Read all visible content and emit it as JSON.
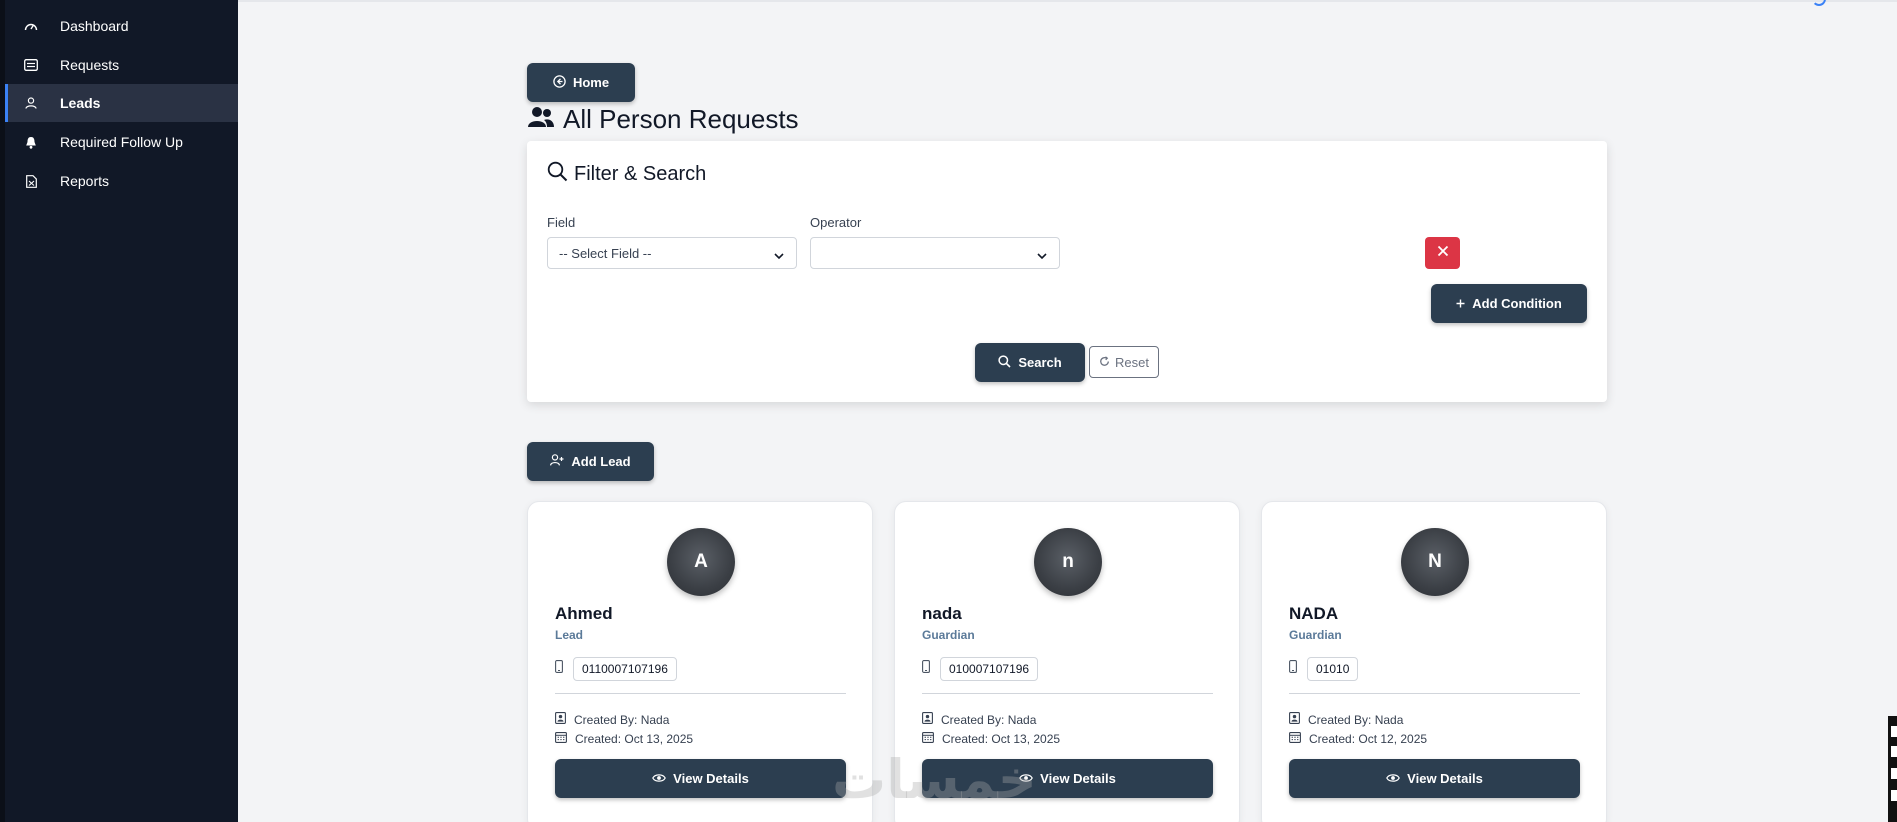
{
  "sidebar": {
    "items": [
      {
        "label": "Dashboard",
        "icon": "gauge-icon",
        "active": false
      },
      {
        "label": "Requests",
        "icon": "list-icon",
        "active": false
      },
      {
        "label": "Leads",
        "icon": "user-icon",
        "active": true
      },
      {
        "label": "Required Follow Up",
        "icon": "bell-icon",
        "active": false
      },
      {
        "label": "Reports",
        "icon": "report-file-icon",
        "active": false
      }
    ]
  },
  "header": {
    "home_label": "Home",
    "title": "All Person Requests"
  },
  "filter": {
    "title": "Filter & Search",
    "field_label": "Field",
    "field_value": "-- Select Field --",
    "operator_label": "Operator",
    "operator_value": "",
    "add_condition_label": "Add Condition",
    "search_label": "Search",
    "reset_label": "Reset"
  },
  "add_lead_label": "Add Lead",
  "cards": [
    {
      "initial": "A",
      "name": "Ahmed",
      "role": "Lead",
      "phone": "0110007107196",
      "created_by": "Created By: Nada",
      "created": "Created: Oct 13, 2025",
      "view_label": "View Details"
    },
    {
      "initial": "n",
      "name": "nada",
      "role": "Guardian",
      "phone": "010007107196",
      "created_by": "Created By: Nada",
      "created": "Created: Oct 13, 2025",
      "view_label": "View Details"
    },
    {
      "initial": "N",
      "name": "NADA",
      "role": "Guardian",
      "phone": "01010",
      "created_by": "Created By: Nada",
      "created": "Created: Oct 12, 2025",
      "view_label": "View Details"
    }
  ],
  "watermark": "خمسات",
  "colors": {
    "sidebar_bg": "#111827",
    "primary_button": "#2c3e50",
    "danger": "#dc3545",
    "role_text": "#5b7a99",
    "accent": "#3b82f6"
  }
}
